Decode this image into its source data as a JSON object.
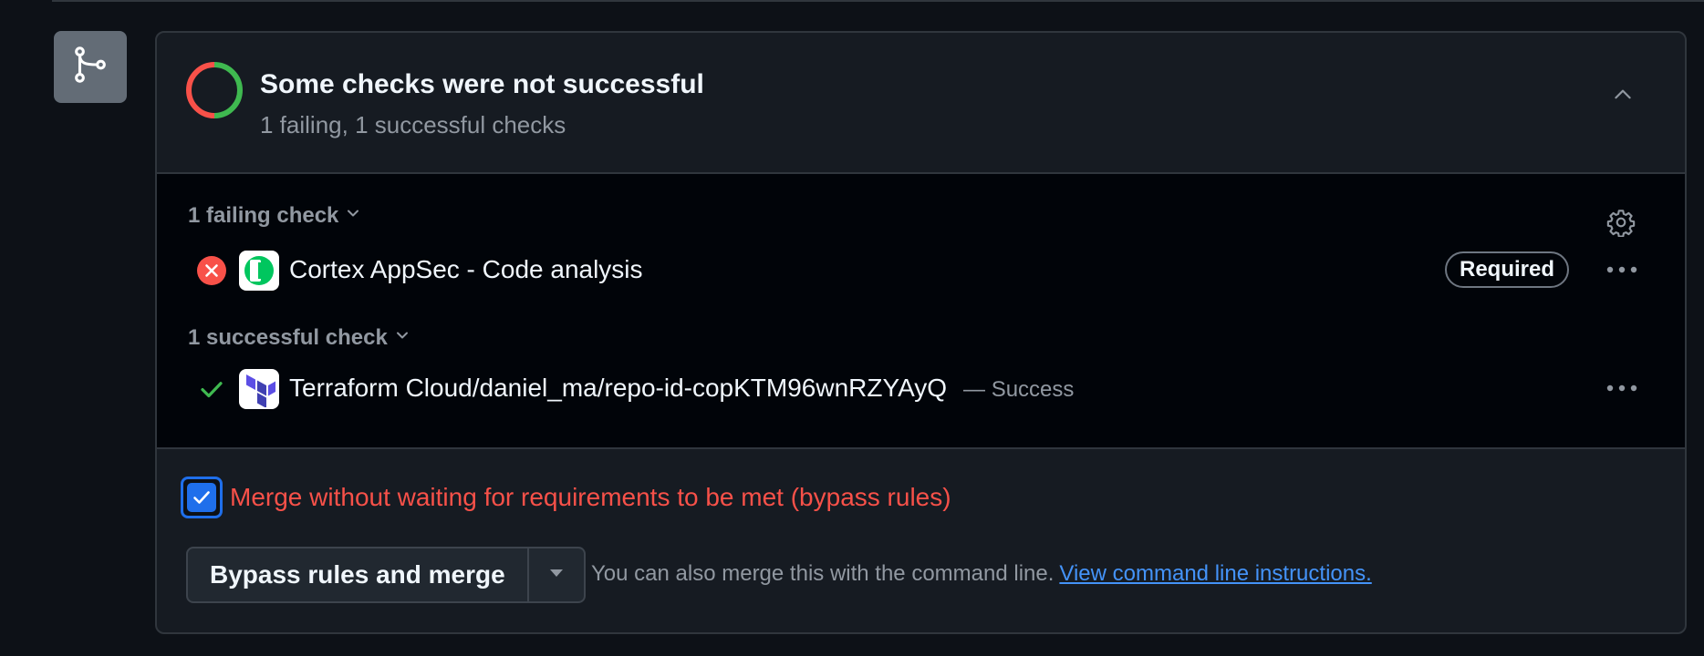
{
  "header": {
    "title": "Some checks were not successful",
    "subtitle": "1 failing, 1 successful checks"
  },
  "failing_group": {
    "label": "1 failing check"
  },
  "successful_group": {
    "label": "1 successful check"
  },
  "checks": [
    {
      "name": "Cortex AppSec - Code analysis",
      "state": "failure",
      "badge": "Required",
      "status_text": ""
    },
    {
      "name": "Terraform Cloud/daniel_ma/repo-id-copKTM96wnRZYAyQ",
      "state": "success",
      "badge": "",
      "status_text": "— Success"
    }
  ],
  "bypass": {
    "checked": true,
    "label": "Merge without waiting for requirements to be met (bypass rules)"
  },
  "merge": {
    "button_label": "Bypass rules and merge",
    "cli_text": "You can also merge this with the command line.",
    "cli_link": "View command line instructions."
  },
  "colors": {
    "background": "#0d1117",
    "panel": "#161b22",
    "checks_background": "#010409",
    "failure": "#f85149",
    "success": "#3fb950",
    "link": "#4493f8",
    "accent": "#1f6feb"
  },
  "icons": {
    "merge_badge": "git-merge-icon",
    "status": "status-ring-icon",
    "collapse": "chevron-up-icon",
    "settings": "gear-icon",
    "failure": "x-circle-fill-icon",
    "success": "check-icon",
    "more": "kebab-horizontal-icon",
    "dropdown": "triangle-down-icon"
  }
}
